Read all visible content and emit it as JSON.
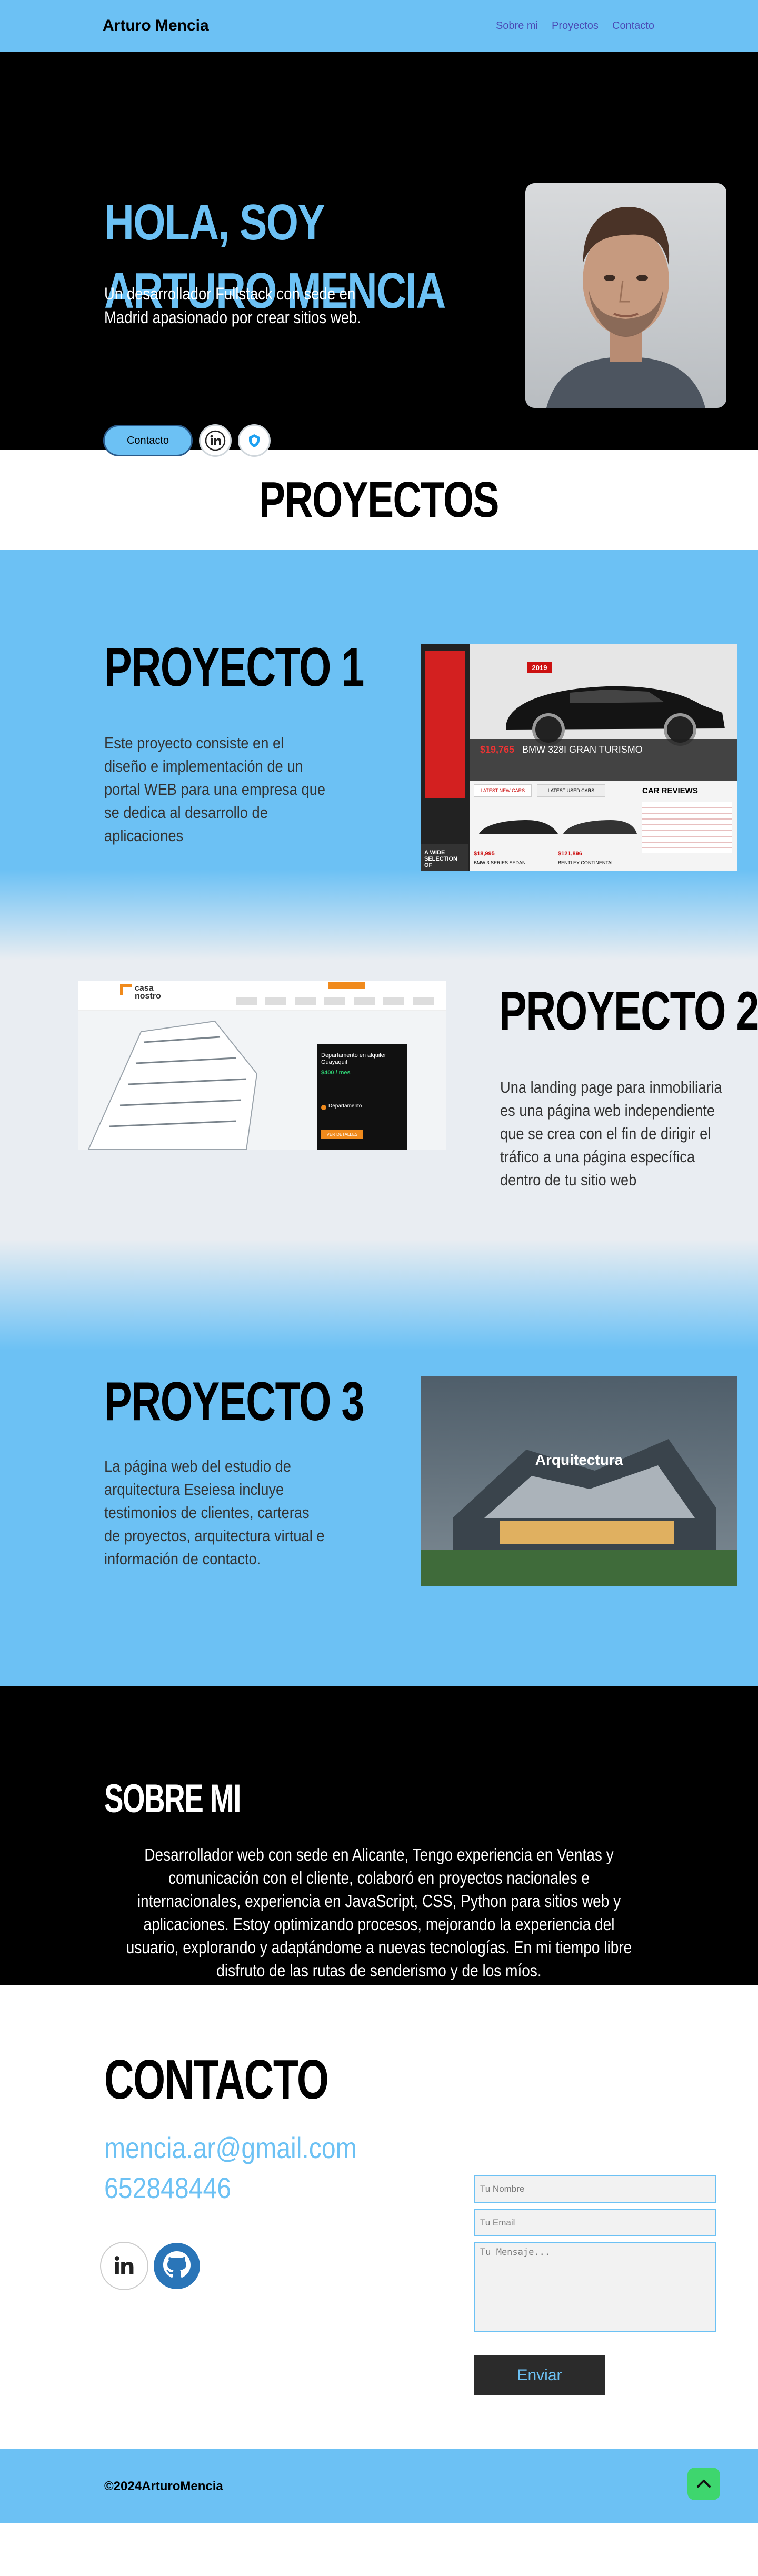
{
  "nav": {
    "brand": "Arturo Mencia",
    "links": [
      "Sobre mi",
      "Proyectos",
      "Contacto"
    ]
  },
  "hero": {
    "title_line1": "HOLA, SOY",
    "title_line2": "ARTURO MENCIA",
    "subtitle": "Un desarrollador Fullstack con sede en Madrid apasionado por crear sitios web.",
    "contact_button": "Contacto",
    "icons": [
      "linkedin-icon",
      "codepen-icon"
    ]
  },
  "projects": {
    "heading": "PROYECTOS",
    "items": [
      {
        "title": "PROYECTO 1",
        "description": "Este proyecto consiste en el diseño e implementación de un portal WEB para una empresa que se dedica al desarrollo de aplicaciones",
        "shot": {
          "badge": "2019",
          "price": "$19,765",
          "model": "BMW 328I GRAN TURISMO",
          "latest_new": "LATEST NEW CARS",
          "latest_used": "LATEST USED CARS",
          "reviews": "CAR REVIEWS",
          "wide": "A WIDE SELECTION OF",
          "price2": "$18,995",
          "price3": "$121,896",
          "car2": "BMW 3 SERIES SEDAN",
          "car3": "BENTLEY CONTINENTAL"
        }
      },
      {
        "title": "PROYECTO 2",
        "description": "Una landing page para inmobiliaria es una página web independiente que se crea con el fin de dirigir el tráfico a una página específica dentro de tu sitio web",
        "shot": {
          "logo": "casa nostro",
          "card_title": "Departamento en alquiler Guayaquil",
          "price": "$400 / mes",
          "type": "Departamento",
          "button": "VER DETALLES"
        }
      },
      {
        "title": "PROYECTO 3",
        "description": "La página web del estudio de arquitectura Eseiesa incluye testimonios de clientes, carteras de proyectos,  arquitectura virtual e información de contacto.",
        "shot": {
          "heading": "Arquitectura"
        }
      }
    ]
  },
  "about": {
    "heading": "SOBRE MI",
    "text": "Desarrollador web con sede en Alicante, Tengo experiencia en Ventas y comunicación con el cliente, colaboró en proyectos nacionales e internacionales, experiencia en JavaScript, CSS, Python para sitios web y aplicaciones. Estoy optimizando procesos, mejorando la experiencia del usuario, explorando y adaptándome a nuevas tecnologías. En mi tiempo libre disfruto de las rutas de senderismo y de los míos."
  },
  "contact": {
    "heading": "CONTACTO",
    "email": "mencia.ar@gmail.com",
    "phone": "652848446",
    "form": {
      "name_placeholder": "Tu Nombre",
      "email_placeholder": "Tu Email",
      "message_placeholder": "Tu Mensaje...",
      "submit": "Enviar"
    },
    "icons": [
      "linkedin-icon",
      "github-icon"
    ]
  },
  "footer": {
    "copyright": "©2024ArturoMencia"
  },
  "colors": {
    "accent": "#6cc1f4",
    "dark": "#000000",
    "link": "#4a4ab5",
    "top_button": "#3ed66e"
  }
}
